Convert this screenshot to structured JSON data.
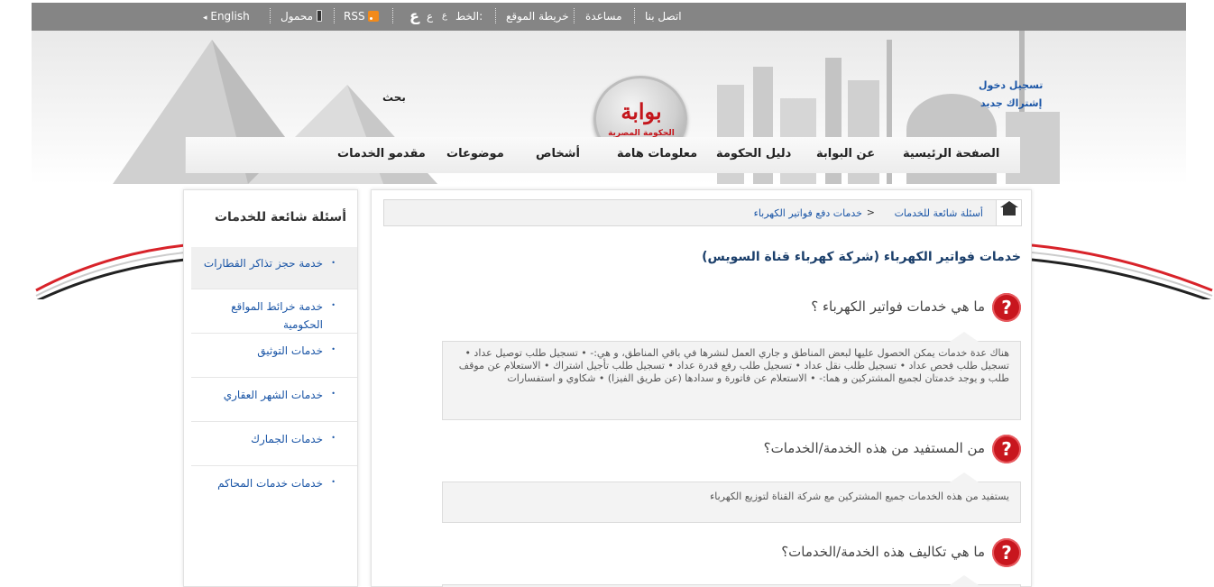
{
  "topbar": {
    "contact": "اتصل بنا",
    "help": "مساعدة",
    "sitemap": "خريطة الموقع",
    "font_label": "الخط:",
    "font_small": "ع",
    "font_medium": "ع",
    "font_large": "ع",
    "rss": "RSS",
    "mobile": "محمول",
    "english": "English",
    "arrow": "◂"
  },
  "header": {
    "logo_main": "بوابة",
    "logo_sub": "الحكومة المصرية",
    "search_label": "بحث",
    "login": "تسجيل دخول",
    "signup": "إشتراك جديد"
  },
  "nav": {
    "items": [
      "الصفحة الرئيسية",
      "عن البوابة",
      "دليل الحكومة",
      "معلومات هامة",
      "أشخاص",
      "موضوعات",
      "مقدمو الخدمات"
    ]
  },
  "sidebar": {
    "title": "أسئلة شائعة للخدمات",
    "bullet": "•",
    "items": [
      {
        "label": "خدمة حجز تذاكر القطارات"
      },
      {
        "label": "خدمة خرائط المواقع الحكومية"
      },
      {
        "label": "خدمات التوثيق"
      },
      {
        "label": "خدمات الشهر العقاري"
      },
      {
        "label": "خدمات الجمارك"
      },
      {
        "label": "خدمات خدمات المحاكم"
      }
    ]
  },
  "breadcrumb": {
    "item1": "أسئلة شائعة للخدمات",
    "sep": ">",
    "item2": "خدمات دفع فواتير الكهرباء"
  },
  "main": {
    "title": "خدمات فواتير الكهرباء (شركة كهرباء قناة السويس)",
    "qmark": "?",
    "questions": [
      {
        "q": "ما هي خدمات فواتير الكهرباء ؟",
        "a": "هناك عدة خدمات يمكن الحصول عليها لبعض المناطق و جاري العمل لنشرها في باقي المناطق، و هي:- • تسجيل طلب توصيل عداد • تسجيل طلب فحص عداد • تسجيل طلب نقل عداد • تسجيل طلب رفع قدرة عداد • تسجيل طلب تأجيل اشتراك • الاستعلام عن موقف طلب و يوجد خدمتان لجميع المشتركين و هما:- • الاستعلام عن فاتورة و سدادها (عن طريق الفيزا) • شكاوي و استفسارات"
      },
      {
        "q": "من المستفيد من هذه الخدمة/الخدمات؟",
        "a": "يستفيد من هذه الخدمات جميع المشتركين مع شركة القناة لتوزيع الكهرباء"
      },
      {
        "q": "ما هي تكاليف هذه الخدمة/الخدمات؟",
        "a": ""
      }
    ]
  },
  "colors": {
    "topbar": "#858585",
    "link": "#1a55a6",
    "title": "#1b3f6b",
    "qicon": "#c8161e",
    "flag_red": "#d8232a",
    "flag_black": "#222222"
  }
}
